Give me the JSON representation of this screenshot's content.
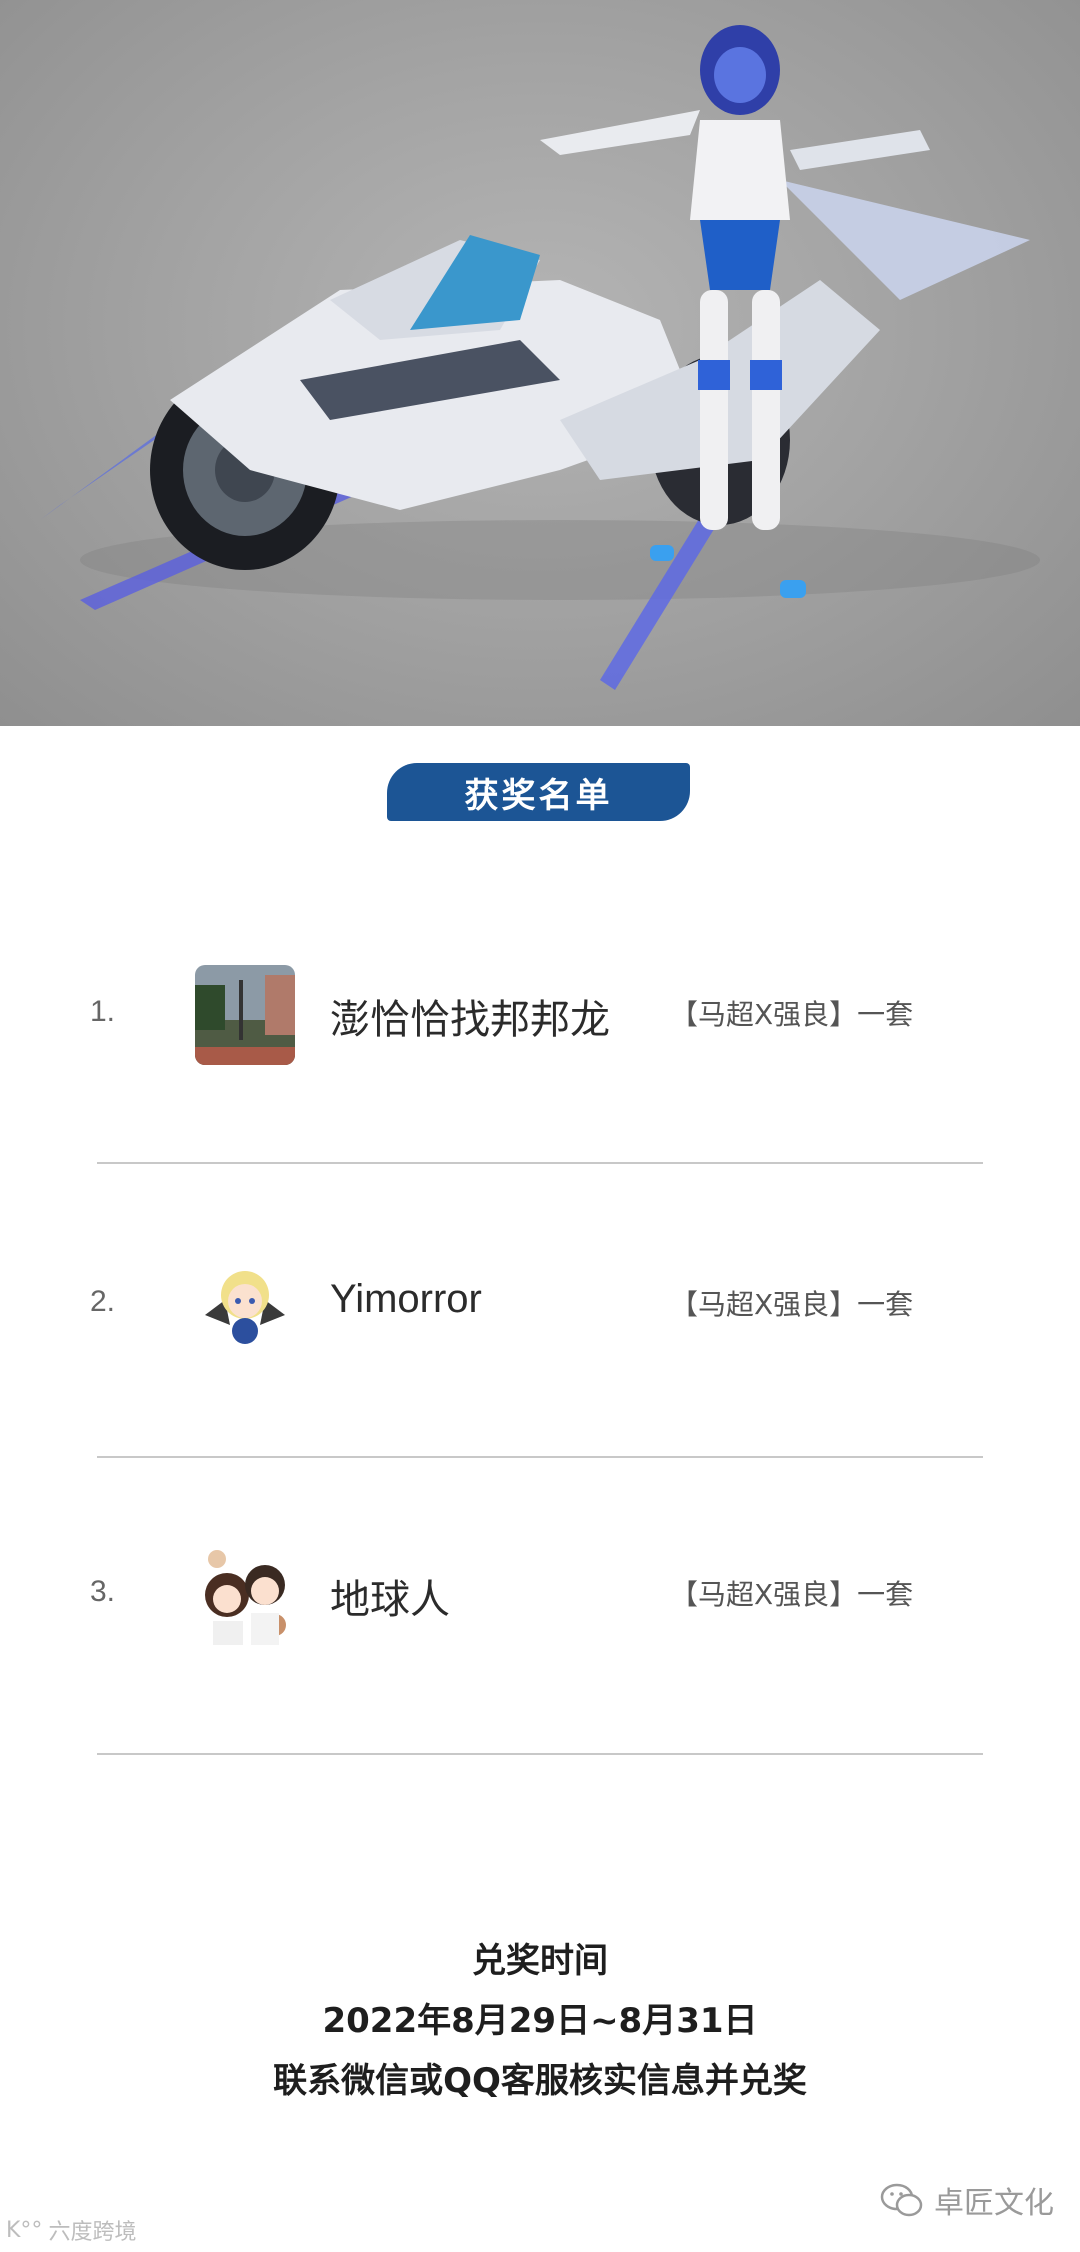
{
  "hero": {
    "image": "action-figure-with-motorcycle-photo"
  },
  "ribbon": {
    "title": "获奖名单"
  },
  "winners": [
    {
      "rank": "1.",
      "name": "澎恰恰找邦邦龙",
      "prize": "【马超X强良】一套",
      "avatar": "street-photo-avatar"
    },
    {
      "rank": "2.",
      "name": "Yimorror",
      "prize": "【马超X强良】一套",
      "avatar": "anime-angel-boy-avatar"
    },
    {
      "rank": "3.",
      "name": "地球人",
      "prize": "【马超X强良】一套",
      "avatar": "cartoon-couple-avatar"
    }
  ],
  "redeem": {
    "heading": "兑奖时间",
    "dates": "2022年8月29日~8月31日",
    "instruction": "联系微信或QQ客服核实信息并兑奖"
  },
  "watermarks": {
    "left": "六度跨境",
    "left_prefix": "K°°",
    "right": "卓匠文化"
  },
  "colors": {
    "ribbon": "#1c5595",
    "divider": "#c8c8c8"
  }
}
